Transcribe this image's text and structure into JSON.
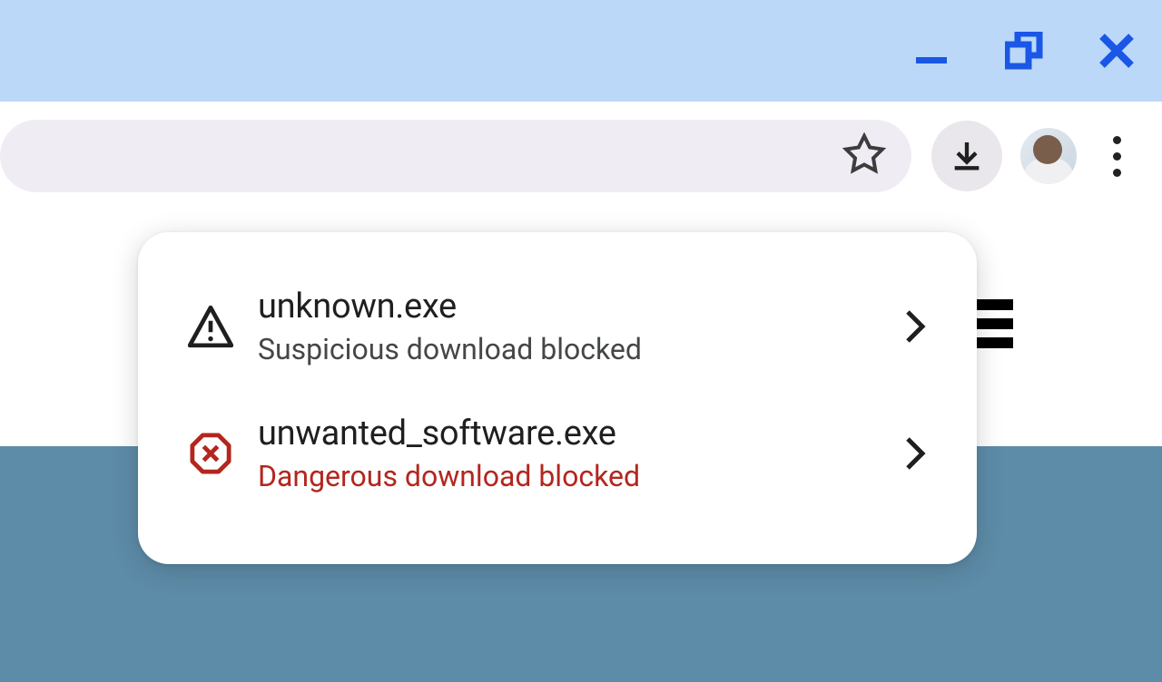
{
  "window_controls": {
    "minimize": "minimize",
    "restore": "restore",
    "close": "close",
    "color": "#1A73E8"
  },
  "toolbar": {
    "bookmark_tooltip": "Bookmark",
    "downloads_tooltip": "Downloads",
    "profile_tooltip": "Profile",
    "more_tooltip": "More"
  },
  "downloads": [
    {
      "icon": "warning-triangle",
      "filename": "unknown.exe",
      "status": "Suspicious download blocked",
      "severity": "warning"
    },
    {
      "icon": "stop-x",
      "filename": "unwanted_software.exe",
      "status": "Dangerous download blocked",
      "severity": "danger"
    }
  ],
  "colors": {
    "titlebar": "#BBD8F8",
    "accent": "#1A73E8",
    "danger": "#B3261E",
    "page_accent": "#5D8CA8"
  }
}
